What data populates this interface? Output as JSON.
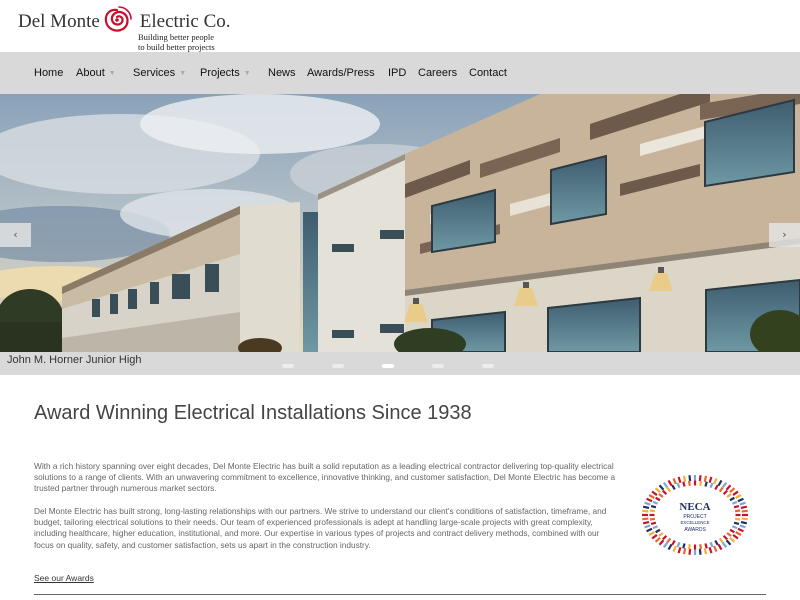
{
  "brand": {
    "name_left": "Del Monte",
    "name_right": "Electric Co.",
    "tagline_1": "Building better people",
    "tagline_2": "to build better projects",
    "accent": "#c8102e"
  },
  "nav": {
    "items": [
      {
        "label": "Home"
      },
      {
        "label": "About"
      },
      {
        "label": "Services"
      },
      {
        "label": "Projects"
      },
      {
        "label": "News"
      },
      {
        "label": "Awards/Press"
      },
      {
        "label": "IPD"
      },
      {
        "label": "Careers"
      },
      {
        "label": "Contact"
      }
    ]
  },
  "hero": {
    "prev_icon": "chevron-left-icon",
    "next_icon": "chevron-right-icon",
    "prev_glyph": "‹",
    "next_glyph": "›",
    "caption": "John M. Horner Junior High",
    "slide_count": 5,
    "active_slide": 3
  },
  "main": {
    "headline": "Award Winning Electrical Installations Since 1938",
    "para_1": "With a rich history spanning over eight decades, Del Monte Electric has built a solid reputation as a leading electrical contractor delivering top-quality electrical solutions to a range of clients. With an unwavering commitment to excellence, innovative thinking, and customer satisfaction, Del Monte Electric has become a trusted partner through numerous market sectors.",
    "para_2": "Del Monte Electric has built strong, long-lasting relationships with our partners. We strive to understand our client's conditions of satisfaction, timeframe, and budget, tailoring electrical solutions to their needs. Our team of experienced professionals is adept at handling large-scale projects with great complexity, including healthcare, higher education, institutional, and more. Our expertise in various types of projects and contract delivery methods, combined with our focus on quality, safety, and customer satisfaction, sets us apart in the construction industry.",
    "awards_link": "See our Awards"
  },
  "badge": {
    "line_1": "NECA",
    "line_2": "PROJECT",
    "line_3": "EXCELLENCE",
    "line_4": "AWARDS"
  }
}
